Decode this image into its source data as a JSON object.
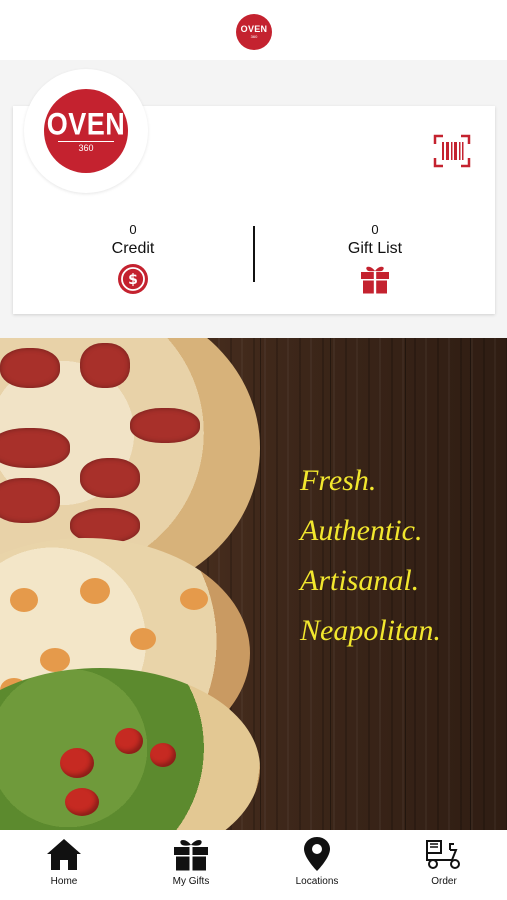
{
  "brand": {
    "logo_word": "OVEN",
    "logo_number": "360"
  },
  "card": {
    "credit": {
      "count": "0",
      "label": "Credit",
      "icon": "dollar-coin-icon"
    },
    "gifts": {
      "count": "0",
      "label": "Gift List",
      "icon": "gift-icon"
    },
    "scan_icon": "barcode-scan-icon"
  },
  "hero": {
    "lines": [
      "Fresh.",
      "Authentic.",
      "Artisanal.",
      "Neapolitan."
    ]
  },
  "tabs": [
    {
      "label": "Home",
      "icon": "home-icon"
    },
    {
      "label": "My Gifts",
      "icon": "gift-icon"
    },
    {
      "label": "Locations",
      "icon": "map-pin-icon"
    },
    {
      "label": "Order",
      "icon": "delivery-scooter-icon"
    }
  ],
  "colors": {
    "brand_red": "#c4222f",
    "tagline_yellow": "#f2e72e",
    "text": "#111111"
  }
}
